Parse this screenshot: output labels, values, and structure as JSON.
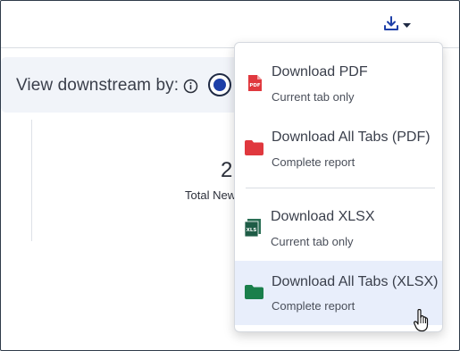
{
  "filter": {
    "label": "View downstream by:",
    "info_icon": "info-circle-icon"
  },
  "metric": {
    "value": "2",
    "label": "Total New"
  },
  "toolbar": {
    "download_icon": "download-icon",
    "caret_icon": "caret-down-icon"
  },
  "download_menu": {
    "items": [
      {
        "title": "Download PDF",
        "subtitle": "Current tab only",
        "icon": "pdf-file-icon",
        "highlighted": false
      },
      {
        "title": "Download All Tabs (PDF)",
        "subtitle": "Complete report",
        "icon": "red-folder-icon",
        "highlighted": false
      },
      {
        "title": "Download XLSX",
        "subtitle": "Current tab only",
        "icon": "xls-file-icon",
        "highlighted": false
      },
      {
        "title": "Download All Tabs (XLSX)",
        "subtitle": "Complete report",
        "icon": "green-folder-icon",
        "highlighted": true
      }
    ]
  },
  "colors": {
    "pdf_red": "#e0383e",
    "xlsx_green": "#1a7f4b",
    "radio_blue": "#1d3fa8",
    "highlight_bg": "#e8eefb"
  }
}
